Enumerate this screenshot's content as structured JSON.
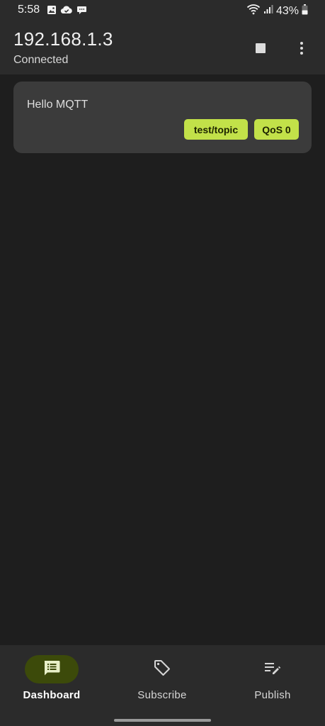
{
  "status_bar": {
    "time": "5:58",
    "battery": "43%",
    "left_icons": [
      "image-icon",
      "cloud-check-icon",
      "chat-bubble-icon"
    ],
    "right_icons": [
      "wifi-icon",
      "signal-icon",
      "battery-icon"
    ]
  },
  "app_bar": {
    "title": "192.168.1.3",
    "subtitle": "Connected",
    "actions": [
      "stop-icon",
      "more-vert-icon"
    ]
  },
  "messages": [
    {
      "text": "Hello MQTT",
      "topic": "test/topic",
      "qos": "QoS 0"
    }
  ],
  "bottom_nav": {
    "items": [
      {
        "label": "Dashboard",
        "icon": "dashboard-icon",
        "active": true
      },
      {
        "label": "Subscribe",
        "icon": "tag-icon",
        "active": false
      },
      {
        "label": "Publish",
        "icon": "edit-note-icon",
        "active": false
      }
    ]
  },
  "colors": {
    "accent": "#c2e149",
    "active_nav_bg": "#3c4a0a",
    "surface": "#2b2b2b",
    "background": "#1e1e1e",
    "card": "#3b3b3b"
  }
}
